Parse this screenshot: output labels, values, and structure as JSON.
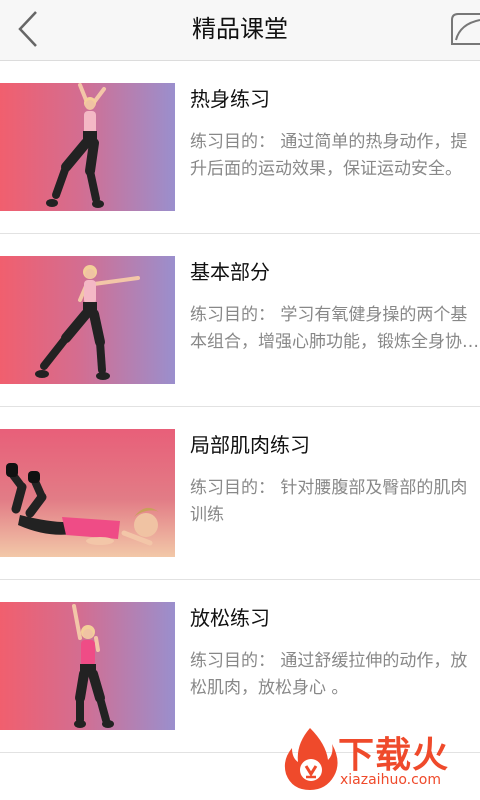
{
  "header": {
    "title": "精品课堂",
    "back_icon": "chevron-left-icon",
    "share_icon": "share-icon"
  },
  "items": [
    {
      "title": "热身练习",
      "description": "练习目的： 通过简单的热身动作，提升后面的运动效果，保证运动安全。"
    },
    {
      "title": "基本部分",
      "description": "练习目的： 学习有氧健身操的两个基本组合，增强心肺功能，锻炼全身协调性。"
    },
    {
      "title": "局部肌肉练习",
      "description": "练习目的： 针对腰腹部及臀部的肌肉训练"
    },
    {
      "title": "放松练习",
      "description": "练习目的： 通过舒缓拉伸的动作，放松肌肉，放松身心 。"
    }
  ],
  "watermark": {
    "brand": "下载火",
    "domain": "xiazaihuo.com"
  },
  "colors": {
    "accent": "#ef4a2b",
    "thumb_start": "#f15f6e",
    "thumb_end": "#9a8fcd",
    "desc_text": "#888888"
  }
}
